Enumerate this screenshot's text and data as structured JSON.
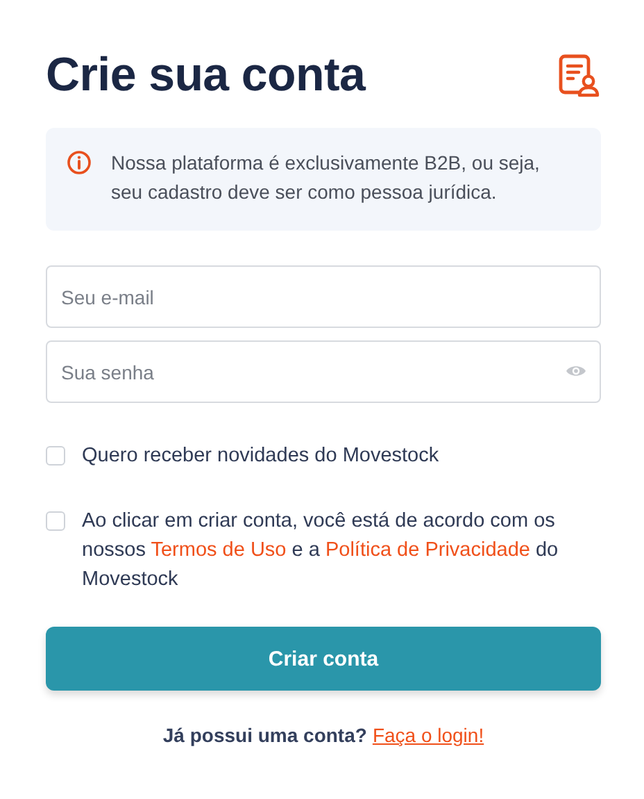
{
  "header": {
    "title": "Crie sua conta"
  },
  "notice": {
    "text": "Nossa plataforma é exclusivamente B2B, ou seja, seu cadastro deve ser como pessoa jurídica."
  },
  "fields": [
    {
      "kind": "email",
      "placeholder": "Seu e-mail"
    },
    {
      "kind": "password",
      "placeholder": "Sua senha"
    }
  ],
  "checkboxes": [
    {
      "checked": false,
      "parts": [
        {
          "kind": "text",
          "text": "Quero receber novidades do Movestock"
        }
      ]
    },
    {
      "checked": false,
      "parts": [
        {
          "kind": "text",
          "text": "Ao clicar em criar conta, você está de acordo com os nossos "
        },
        {
          "kind": "link",
          "text": "Termos de Uso"
        },
        {
          "kind": "text",
          "text": " e a "
        },
        {
          "kind": "link",
          "text": "Política de Privacidade"
        },
        {
          "kind": "text",
          "text": " do Movestock"
        }
      ]
    }
  ],
  "submit": {
    "label": "Criar conta"
  },
  "footer": {
    "prompt": "Já possui uma conta?",
    "link": "Faça o login!"
  }
}
